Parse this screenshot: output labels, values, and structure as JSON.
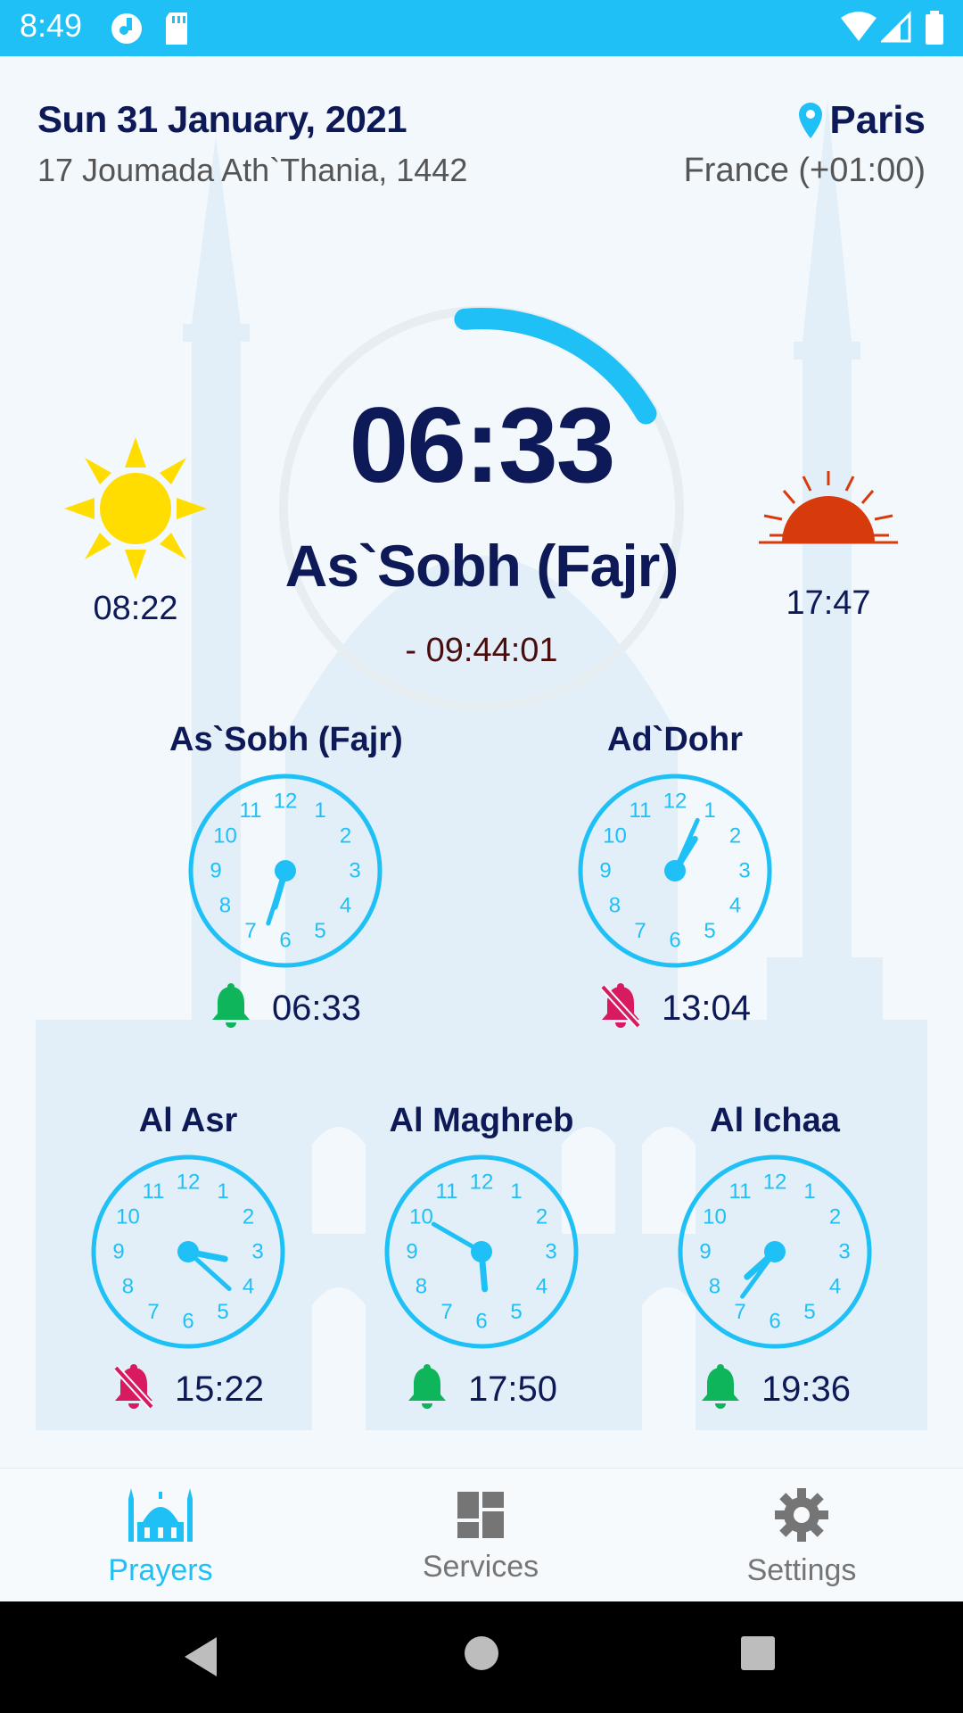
{
  "status_bar": {
    "time": "8:49"
  },
  "header": {
    "date": "Sun 31 January, 2021",
    "hijri_date": "17 Joumada Ath`Thania, 1442",
    "city": "Paris",
    "country": "France (+01:00)"
  },
  "sunrise": {
    "icon": "sun-icon",
    "time": "08:22"
  },
  "sunset": {
    "icon": "sunset-icon",
    "time": "17:47"
  },
  "next_prayer": {
    "time": "06:33",
    "name": "As`Sobh (Fajr)",
    "countdown": "- 09:44:01"
  },
  "prayers": [
    {
      "name": "As`Sobh (Fajr)",
      "time": "06:33",
      "alarm": "on"
    },
    {
      "name": "Ad`Dohr",
      "time": "13:04",
      "alarm": "off"
    },
    {
      "name": "Al Asr",
      "time": "15:22",
      "alarm": "off"
    },
    {
      "name": "Al Maghreb",
      "time": "17:50",
      "alarm": "on"
    },
    {
      "name": "Al Ichaa",
      "time": "19:36",
      "alarm": "on"
    }
  ],
  "nav": {
    "prayers": "Prayers",
    "services": "Services",
    "settings": "Settings",
    "active": "prayers"
  },
  "colors": {
    "accent": "#1ec0f6",
    "navy": "#0e1a57",
    "bell_on": "#0fb55a",
    "bell_off": "#d81b60",
    "sun": "#ffdd00",
    "sunset": "#d83b0b"
  }
}
